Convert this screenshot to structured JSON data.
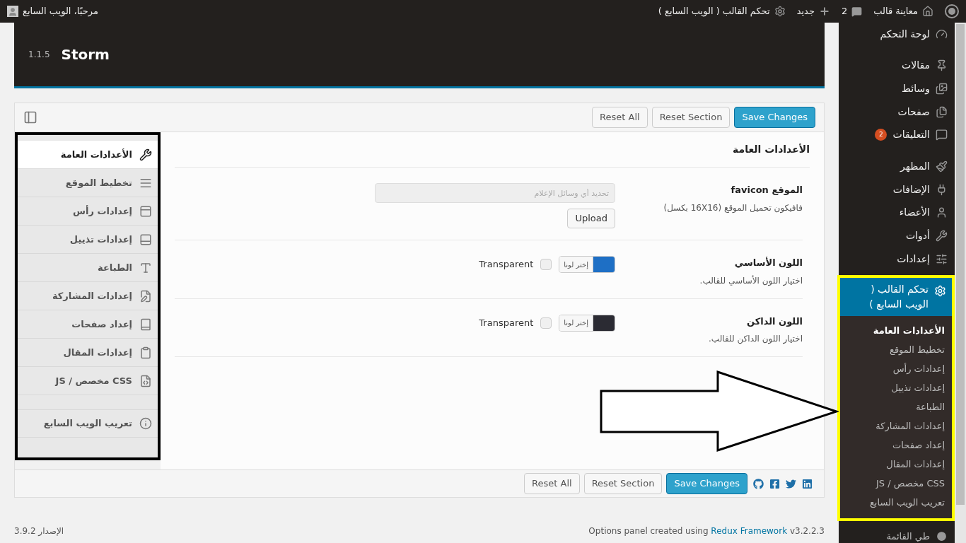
{
  "admin_bar": {
    "site": "معاينة قالب",
    "comments": "2",
    "new": "جديد",
    "theme_panel": "تحكم القالب ( الويب السابع )",
    "greeting": "مرحبًا، الويب السابع"
  },
  "admin_menu": {
    "items": [
      {
        "label": "لوحة التحكم",
        "gap_before": false
      },
      {
        "label": "مقالات",
        "gap_before": true
      },
      {
        "label": "وسائط",
        "gap_before": false
      },
      {
        "label": "صفحات",
        "gap_before": false
      },
      {
        "label": "التعليقات",
        "badge": "2",
        "gap_before": false
      },
      {
        "label": "المظهر",
        "gap_before": true
      },
      {
        "label": "الإضافات",
        "gap_before": false
      },
      {
        "label": "الأعضاء",
        "gap_before": false
      },
      {
        "label": "أدوات",
        "gap_before": false
      },
      {
        "label": "إعدادات",
        "gap_before": false
      }
    ],
    "active": {
      "label": "تحكم القالب ( الويب السابع )",
      "submenu": [
        {
          "label": "الأعدادات العامة",
          "selected": true
        },
        {
          "label": "تخطيط الموقع",
          "selected": false
        },
        {
          "label": "إعدادات رأس",
          "selected": false
        },
        {
          "label": "إعدادات تذييل",
          "selected": false
        },
        {
          "label": "الطباعة",
          "selected": false
        },
        {
          "label": "إعدادات المشاركة",
          "selected": false
        },
        {
          "label": "إعداد صفحات",
          "selected": false
        },
        {
          "label": "إعدادات المقال",
          "selected": false
        },
        {
          "label": "CSS مخصص / JS",
          "selected": false
        },
        {
          "label": "تعريب الويب السابع",
          "selected": false
        }
      ]
    },
    "collapse": "طي القائمة"
  },
  "panel": {
    "theme_name": "Storm",
    "version": "1.1.5",
    "top_buttons": {
      "save": "Save Changes",
      "reset_section": "Reset Section",
      "reset_all": "Reset All"
    },
    "sections": [
      {
        "label": "الأعدادات العامة",
        "selected": true,
        "gap_before": false
      },
      {
        "label": "تخطيط الموقع",
        "selected": false,
        "gap_before": false
      },
      {
        "label": "إعدادات رأس",
        "selected": false,
        "gap_before": false
      },
      {
        "label": "إعدادات تذييل",
        "selected": false,
        "gap_before": false
      },
      {
        "label": "الطباعة",
        "selected": false,
        "gap_before": false
      },
      {
        "label": "إعدادات المشاركة",
        "selected": false,
        "gap_before": false
      },
      {
        "label": "إعداد صفحات",
        "selected": false,
        "gap_before": false
      },
      {
        "label": "إعدادات المقال",
        "selected": false,
        "gap_before": false
      },
      {
        "label": "CSS مخصص / JS",
        "selected": false,
        "gap_before": false
      },
      {
        "label": "تعريب الويب السابع",
        "selected": false,
        "gap_before": true
      }
    ],
    "section_title": "الأعدادات العامة",
    "fields": [
      {
        "kind": "media",
        "title": "الموقع favicon",
        "description": "فافيكون تحميل الموقع (16X16 بكسل)",
        "placeholder": "تحديد أي وسائل الإعلام",
        "button": "Upload"
      },
      {
        "kind": "color",
        "title": "اللون الأساسي",
        "description": "اختيار اللون الأساسي للقالب.",
        "color": "#1e6fc5",
        "picker": "إختر لونا",
        "transparent_label": "Transparent",
        "transparent": false
      },
      {
        "kind": "color",
        "title": "اللون الداكن",
        "description": "اختيار اللون الداكن للقالب.",
        "color": "#2b2b33",
        "picker": "إختر لونا",
        "transparent_label": "Transparent",
        "transparent": false
      }
    ],
    "bottom_buttons": {
      "save": "Save Changes",
      "reset_section": "Reset Section",
      "reset_all": "Reset All"
    }
  },
  "footer": {
    "credit_before": "Options panel created using ",
    "credit_link": "Redux Framework",
    "credit_after": " v3.2.2.3",
    "version": "الإصدار 3.9.2"
  }
}
